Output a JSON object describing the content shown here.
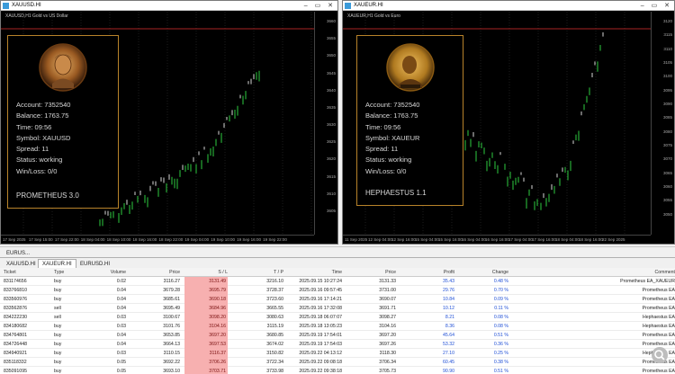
{
  "window_left": {
    "title": "XAUUSD.HI",
    "symbol_label": "XAUUSD,H1  Gold vs US Dollar",
    "panel": {
      "lines": [
        "Account: 7352540",
        "Balance: 1763.75",
        "Time: 09:56",
        "Symbol: XAUUSD",
        "Spread: 11",
        "Status: working",
        "Win/Loss: 0/0"
      ],
      "ea_name": "PROMETHEUS   3.0"
    },
    "time_labels": [
      "17 Sep 2025",
      "17 Sep 15:00",
      "17 Sep 22:00",
      "18 Sep 04:00",
      "18 Sep 10:00",
      "18 Sep 16:00",
      "18 Sep 22:00",
      "19 Sep 04:00",
      "19 Sep 10:00",
      "19 Sep 16:00",
      "19 Sep 22:00"
    ],
    "price_labels": [
      "3660",
      "3655",
      "3650",
      "3645",
      "3640",
      "3635",
      "3630",
      "3625",
      "3620",
      "3615",
      "3610",
      "3605"
    ]
  },
  "window_right": {
    "title": "XAUEUR.HI",
    "symbol_label": "XAUEUR,H1  Gold vs Euro",
    "panel": {
      "lines": [
        "Account: 7352540",
        "Balance: 1763.75",
        "Time: 09:56",
        "Symbol: XAUEUR",
        "Spread: 11",
        "Status: working",
        "Win/Loss: 0/0"
      ],
      "ea_name": "HEPHAESTUS   1.1"
    },
    "time_labels": [
      "11 Sep 2025",
      "12 Sep 04:00",
      "12 Sep 16:00",
      "15 Sep 04:00",
      "15 Sep 16:00",
      "16 Sep 04:00",
      "16 Sep 16:00",
      "17 Sep 04:00",
      "17 Sep 16:00",
      "18 Sep 04:00",
      "18 Sep 16:00",
      "22 Sep 2025"
    ],
    "price_labels": [
      "3120",
      "3115",
      "3110",
      "3105",
      "3100",
      "3095",
      "3090",
      "3085",
      "3080",
      "3075",
      "3070",
      "3065",
      "3060",
      "3055",
      "3050"
    ]
  },
  "chart_tabs": [
    "XAUUSD.HI",
    "XAUEUR.HI",
    "EURUSD.HI"
  ],
  "toolbox_label": "EURUS...",
  "table": {
    "headers": [
      "Ticket",
      "Type",
      "Volume",
      "Price",
      "S / L",
      "T / P",
      "Time",
      "Price",
      "Profit",
      "Change",
      "Comment"
    ],
    "rows": [
      [
        "831174656",
        "buy",
        "0.02",
        "3116.27",
        "3131.49",
        "3216.10",
        "2025.09.15 10:27:24",
        "3131.33",
        "35.43",
        "0.48 %",
        "Prometheus EA_XAUEUR"
      ],
      [
        "833766810",
        "buy",
        "0.04",
        "3679.28",
        "3695.79",
        "3728.37",
        "2025.09.16 09:57:45",
        "3731.00",
        "29.76",
        "0.70 %",
        "Prometheus EA"
      ],
      [
        "833560976",
        "buy",
        "0.04",
        "3685.61",
        "3690.18",
        "3723.60",
        "2025.09.16 17:14:21",
        "3690.07",
        "10.84",
        "0.09 %",
        "Prometheus EA"
      ],
      [
        "833562876",
        "sell",
        "0.04",
        "3695.49",
        "3684.96",
        "3665.55",
        "2025.09.16 17:32:08",
        "3691.71",
        "10.12",
        "0.11 %",
        "Prometheus EA"
      ],
      [
        "834222230",
        "sell",
        "0.03",
        "3100.67",
        "3098.20",
        "3080.63",
        "2025.09.18 06:07:07",
        "3098.27",
        "8.21",
        "0.08 %",
        "Hephaestus EA"
      ],
      [
        "834180682",
        "buy",
        "0.03",
        "3101.76",
        "3104.16",
        "3115.19",
        "2025.09.18 13:05:23",
        "3104.16",
        "8.36",
        "0.08 %",
        "Hephaestus EA"
      ],
      [
        "834764801",
        "buy",
        "0.04",
        "3653.85",
        "3697.20",
        "3680.85",
        "2025.09.19 17:54:01",
        "3697.20",
        "45.64",
        "0.51 %",
        "Prometheus EA"
      ],
      [
        "834726448",
        "buy",
        "0.04",
        "3664.13",
        "3697.53",
        "3674.02",
        "2025.09.19 17:54:03",
        "3697.26",
        "53.32",
        "0.36 %",
        "Prometheus EA"
      ],
      [
        "834940921",
        "buy",
        "0.03",
        "3110.15",
        "3116.37",
        "3150.82",
        "2025.09.22 04:13:12",
        "3118.30",
        "27.10",
        "0.25 %",
        "Hephaestus EA"
      ],
      [
        "835118332",
        "buy",
        "0.05",
        "3692.22",
        "3706.26",
        "3722.34",
        "2025.09.22 09:08:18",
        "3706.34",
        "60.45",
        "0.38 %",
        "Prometheus EA"
      ],
      [
        "835091095",
        "buy",
        "0.05",
        "3693.10",
        "3703.71",
        "3733.98",
        "2025.09.22 09:38:18",
        "3705.73",
        "90.90",
        "0.51 %",
        "Prometheus EA"
      ]
    ]
  },
  "colors": {
    "panel_border": "#b8832a",
    "candle_up": "#2ecc40",
    "bg": "#000000",
    "price_line": "#e03030"
  },
  "icons": {
    "zoom": "zoom-icon",
    "window_controls": "window-controls-icon"
  }
}
